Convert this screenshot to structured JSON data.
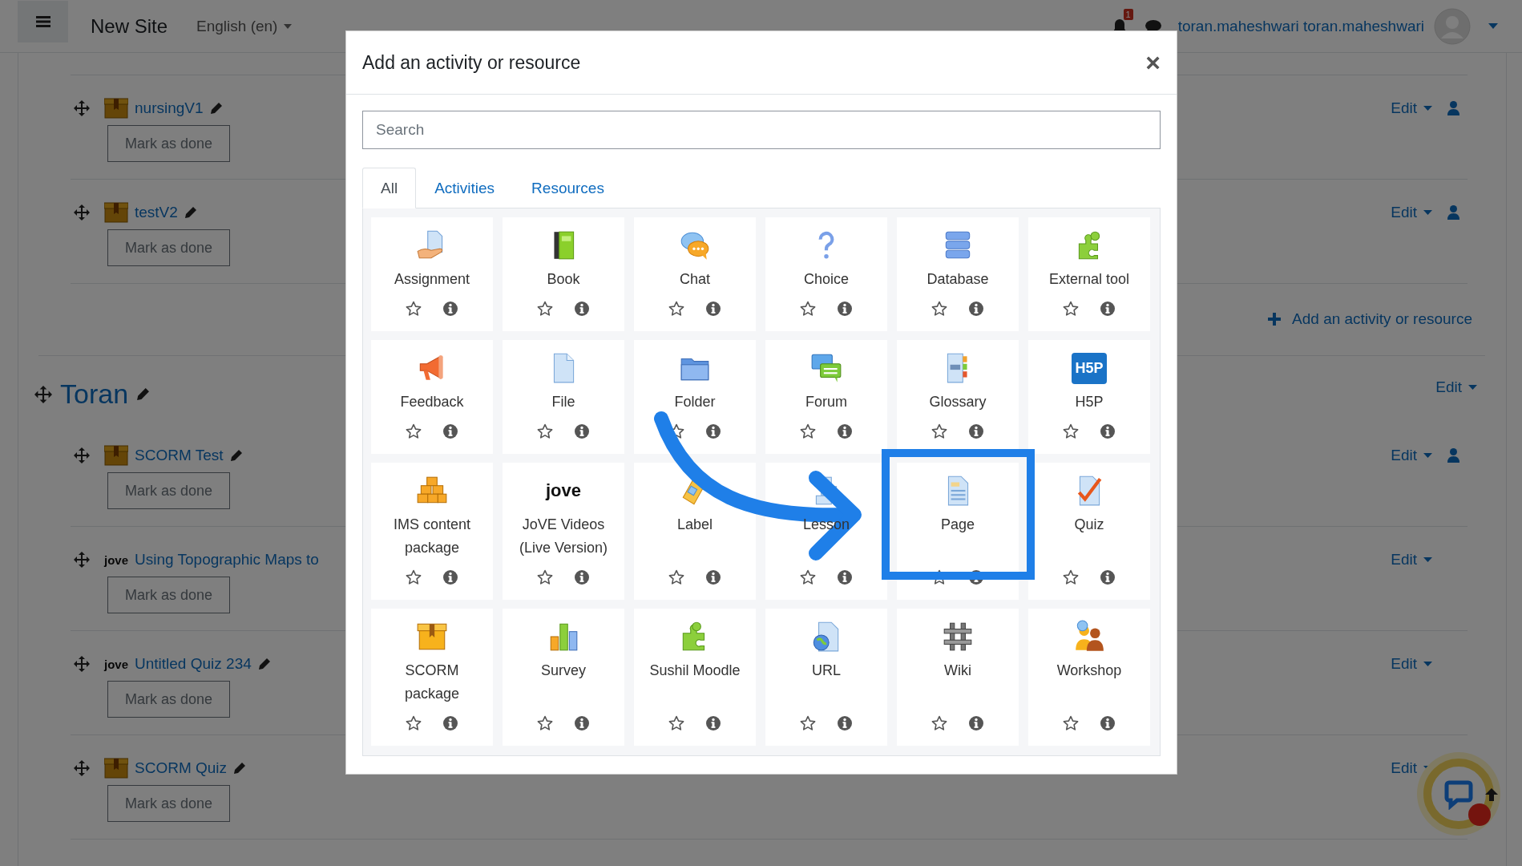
{
  "navbar": {
    "site_name": "New Site",
    "language": "English (en)",
    "notification_count": "1",
    "user_name": "toran.maheshwari toran.maheshwari"
  },
  "course": {
    "items": [
      {
        "title": "nursingV1",
        "editable": true,
        "button": "Mark as done",
        "edit": "Edit",
        "restricted": true
      },
      {
        "title": "testV2",
        "editable": true,
        "button": "Mark as done",
        "edit": "Edit",
        "restricted": true
      }
    ],
    "add_link": "Add an activity or resource",
    "section": {
      "title": "Toran",
      "edit": "Edit",
      "items": [
        {
          "title": "SCORM Test",
          "editable": true,
          "button": "Mark as done",
          "edit": "Edit",
          "restricted": true
        },
        {
          "title": "Using Topographic Maps to",
          "logo": "jove",
          "editable": false,
          "button": "Mark as done",
          "edit": "Edit",
          "restricted": false
        },
        {
          "title": "Untitled Quiz 234",
          "logo": "jove",
          "editable": true,
          "button": "Mark as done",
          "edit": "Edit",
          "restricted": false
        },
        {
          "title": "SCORM Quiz",
          "editable": true,
          "button": "Mark as done",
          "edit": "Edit",
          "restricted": false
        }
      ]
    }
  },
  "modal": {
    "title": "Add an activity or resource",
    "close": "×",
    "search": {
      "placeholder": "Search"
    },
    "tabs": [
      {
        "label": "All",
        "selected": true
      },
      {
        "label": "Activities",
        "selected": false
      },
      {
        "label": "Resources",
        "selected": false
      }
    ],
    "activities": [
      {
        "name": "Assignment"
      },
      {
        "name": "Book"
      },
      {
        "name": "Chat"
      },
      {
        "name": "Choice"
      },
      {
        "name": "Database"
      },
      {
        "name": "External tool"
      },
      {
        "name": "Feedback"
      },
      {
        "name": "File"
      },
      {
        "name": "Folder"
      },
      {
        "name": "Forum"
      },
      {
        "name": "Glossary"
      },
      {
        "name": "H5P",
        "logo": "H5P"
      },
      {
        "name": "IMS content package"
      },
      {
        "name": "JoVE Videos (Live Version)",
        "logo": "jove"
      },
      {
        "name": "Label"
      },
      {
        "name": "Lesson"
      },
      {
        "name": "Page"
      },
      {
        "name": "Quiz"
      },
      {
        "name": "SCORM package"
      },
      {
        "name": "Survey"
      },
      {
        "name": "Sushil Moodle"
      },
      {
        "name": "URL"
      },
      {
        "name": "Wiki"
      },
      {
        "name": "Workshop"
      }
    ]
  }
}
